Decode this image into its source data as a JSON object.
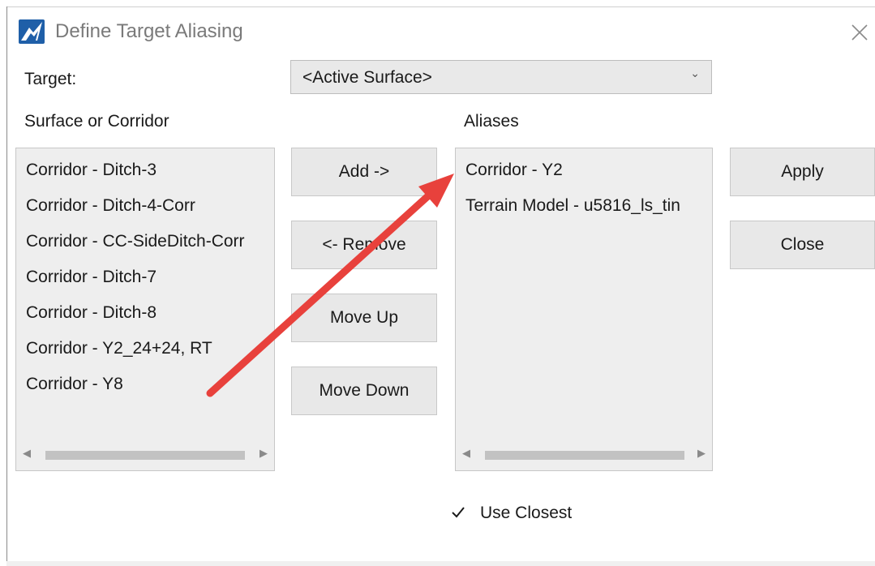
{
  "window": {
    "title": "Define Target Aliasing",
    "icon": "app-logo-icon",
    "close_icon": "close-icon"
  },
  "target": {
    "label": "Target:",
    "selected": "<Active Surface>",
    "dropdown_icon": "chevron-down-icon"
  },
  "surfaces": {
    "header": "Surface or Corridor",
    "items": [
      "Corridor - Ditch-3",
      "Corridor - Ditch-4-Corr",
      "Corridor - CC-SideDitch-Corr",
      "Corridor - Ditch-7",
      "Corridor - Ditch-8",
      "Corridor - Y2_24+24, RT",
      "Corridor - Y8"
    ]
  },
  "aliases": {
    "header": "Aliases",
    "items": [
      "Corridor - Y2",
      "Terrain Model - u5816_ls_tin"
    ]
  },
  "buttons": {
    "add": "Add ->",
    "remove": "<- Remove",
    "move_up": "Move Up",
    "move_down": "Move Down",
    "apply": "Apply",
    "close": "Close"
  },
  "options": {
    "use_closest_label": "Use Closest",
    "use_closest_checked": true
  },
  "colors": {
    "annotation_arrow": "#e8413c",
    "logo_blue": "#1f5fa8"
  }
}
